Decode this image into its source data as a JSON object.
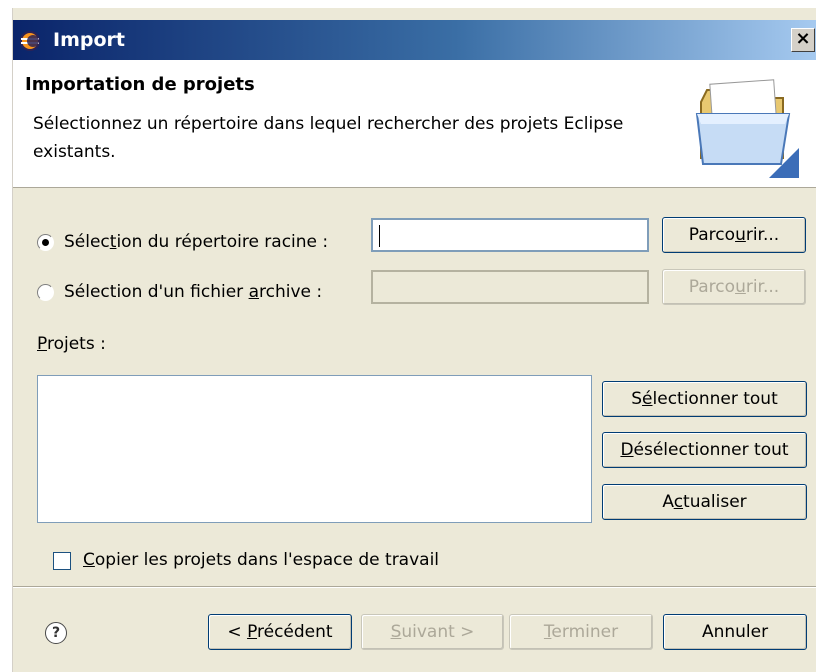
{
  "window": {
    "title": "Import",
    "close_glyph": "×"
  },
  "banner": {
    "title": "Importation de projets",
    "description": "Sélectionnez un répertoire dans lequel rechercher des projets Eclipse existants.",
    "icon": "folder-icon"
  },
  "source": {
    "root_dir_label_pre": "Sélec",
    "root_dir_label_u": "t",
    "root_dir_label_post": "ion du répertoire racine :",
    "root_dir_selected": true,
    "root_dir_value": "",
    "archive_label_pre": "Sélection d'un fichier ",
    "archive_label_u": "a",
    "archive_label_post": "rchive :",
    "archive_selected": false,
    "archive_value": "",
    "browse_pre": "Parco",
    "browse_u": "u",
    "browse_post": "rir..."
  },
  "projects": {
    "label_u": "P",
    "label_post": "rojets :",
    "items": [],
    "select_all_pre": "S",
    "select_all_u": "é",
    "select_all_post": "lectionner tout",
    "deselect_all_u": "D",
    "deselect_all_post": "ésélectionner tout",
    "refresh_pre": "A",
    "refresh_u": "c",
    "refresh_post": "tualiser"
  },
  "options": {
    "copy_checked": false,
    "copy_label_u": "C",
    "copy_label_post": "opier les projets dans l'espace de travail"
  },
  "footer": {
    "help_glyph": "?",
    "back_pre": "< ",
    "back_u": "P",
    "back_post": "récédent",
    "next_u": "S",
    "next_post": "uivant >",
    "finish_u": "T",
    "finish_post": "erminer",
    "cancel_label": "Annuler"
  },
  "colors": {
    "titlebar_start": "#0a246a",
    "titlebar_end": "#a6caf0",
    "dialog_bg": "#ece9d8",
    "disabled_text": "#aca899"
  }
}
